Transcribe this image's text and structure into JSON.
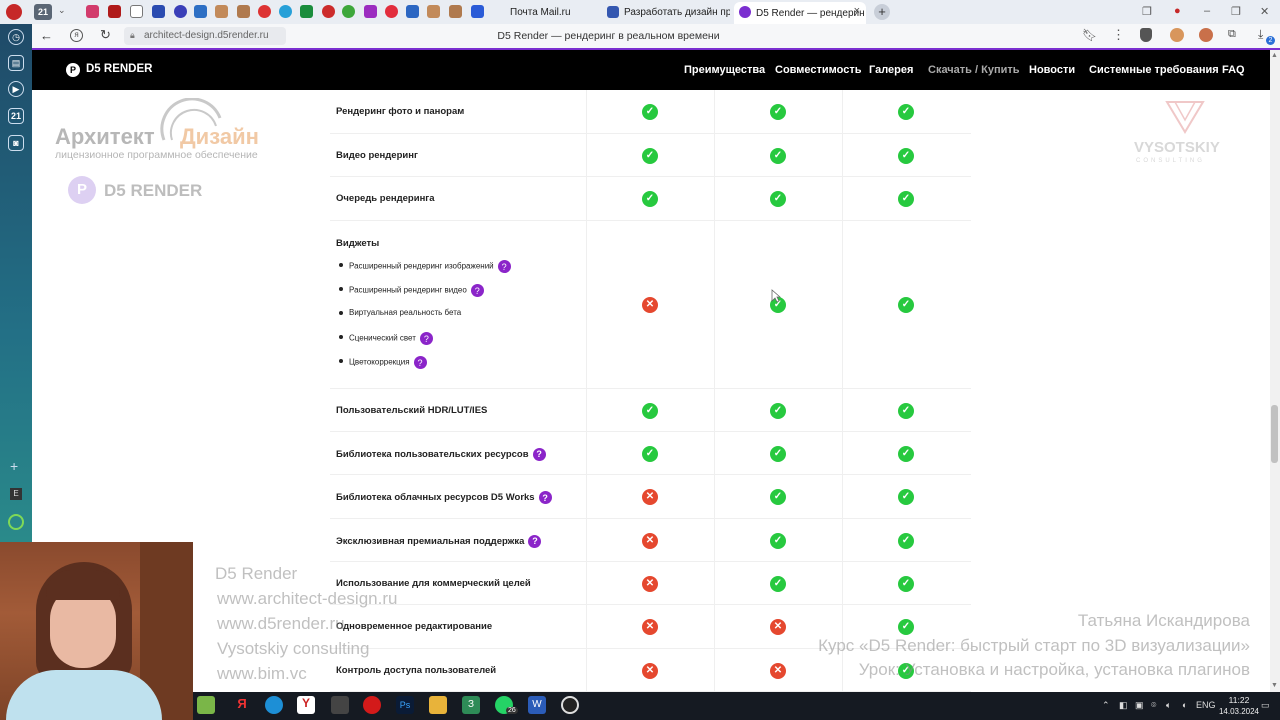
{
  "browser": {
    "workspace_badge": "21",
    "tabs": [
      {
        "label": "Почта Mail.ru",
        "color": "#2a5bd7"
      },
      {
        "label": "Разработать дизайн прое",
        "color": "#3457b0"
      },
      {
        "label": "D5 Render — рендерин",
        "color": "#7b2fd0",
        "active": true
      }
    ],
    "new_tab_symbol": "+",
    "address": "architect-design.d5render.ru",
    "page_title": "D5 Render — рендеринг в реальном времени",
    "sidebar_badge": "21",
    "extension_badge": "2"
  },
  "site": {
    "logo": "D5 RENDER",
    "nav": [
      "Преимущества",
      "Совместимость",
      "Галерея",
      "Скачать / Купить",
      "Новости",
      "Системные требования",
      "FAQ"
    ]
  },
  "watermark": {
    "brand1": "Архитект",
    "brand2": "Дизайн",
    "brand_sub": "лицензионное программное обеспечение",
    "d5": "D5 RENDER",
    "vysotskiy": "VYSOTSKIY",
    "consulting": "CONSULTING",
    "links": [
      "D5 Render",
      "www.architect-design.ru",
      "www.d5render.ru",
      "Vysotskiy consulting",
      "www.bim.vc"
    ],
    "author": "Татьяна Искандирова",
    "course": "Курс «D5 Render: быстрый старт по 3D визуализации»",
    "lesson": "Урок: Установка и настройка, установка плагинов"
  },
  "features": [
    {
      "label": "Рендеринг фото и панорам",
      "info": false,
      "marks": [
        "yes",
        "yes",
        "yes"
      ]
    },
    {
      "label": "Видео рендеринг",
      "info": false,
      "marks": [
        "yes",
        "yes",
        "yes"
      ]
    },
    {
      "label": "Очередь рендеринга",
      "info": false,
      "marks": [
        "yes",
        "yes",
        "yes"
      ]
    },
    {
      "label": "Виджеты",
      "info": false,
      "marks": [
        "no",
        "yes",
        "yes"
      ],
      "subitems": [
        {
          "label": "Расширенный рендеринг изображений",
          "info": true
        },
        {
          "label": "Расширенный рендеринг видео",
          "info": true
        },
        {
          "label": "Виртуальная реальность бета",
          "info": false
        },
        {
          "label": "Сценический свет",
          "info": true
        },
        {
          "label": "Цветокоррекция",
          "info": true
        }
      ]
    },
    {
      "label": "Пользовательский HDR/LUT/IES",
      "info": false,
      "marks": [
        "yes",
        "yes",
        "yes"
      ]
    },
    {
      "label": "Библиотека пользовательских ресурсов",
      "info": true,
      "marks": [
        "yes",
        "yes",
        "yes"
      ]
    },
    {
      "label": "Библиотека облачных ресурсов D5 Works",
      "info": true,
      "marks": [
        "no",
        "yes",
        "yes"
      ]
    },
    {
      "label": "Эксклюзивная премиальная поддержка",
      "info": true,
      "marks": [
        "no",
        "yes",
        "yes"
      ]
    },
    {
      "label": "Использование для коммерческий целей",
      "info": false,
      "marks": [
        "no",
        "yes",
        "yes"
      ]
    },
    {
      "label": "Одновременное редактирование",
      "info": false,
      "marks": [
        "no",
        "no",
        "yes"
      ]
    },
    {
      "label": "Контроль доступа пользователей",
      "info": false,
      "marks": [
        "no",
        "no",
        "yes"
      ]
    }
  ],
  "symbols": {
    "yes": "✓",
    "no": "✕",
    "info": "?"
  },
  "taskbar": {
    "lang": "ENG",
    "time": "11:22",
    "date": "14.03.2024",
    "whatsapp_badge": "26"
  }
}
